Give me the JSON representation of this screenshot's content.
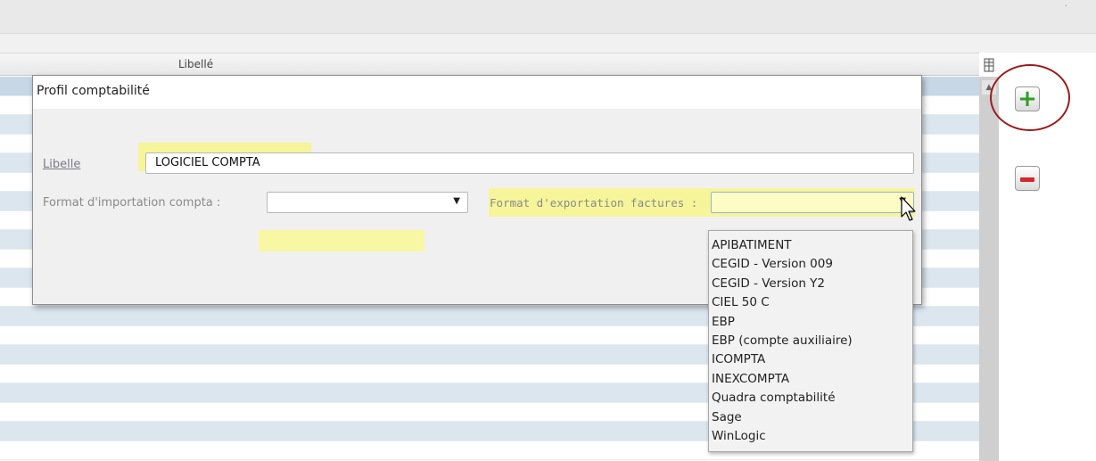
{
  "grid": {
    "column_header": "Libellé",
    "column_button_icon": "column-chooser-icon"
  },
  "dialog": {
    "title": "Profil comptabilité",
    "libelle_label": "Libelle",
    "libelle_value": "LOGICIEL COMPTA",
    "import_label": "Format d'importation compta :",
    "import_value": "",
    "export_label": "Format d'exportation factures :",
    "export_value": ""
  },
  "dropdown": {
    "options": [
      "APIBATIMENT",
      "CEGID - Version 009",
      "CEGID - Version Y2",
      "CIEL 50 C",
      "EBP",
      "EBP (compte auxiliaire)",
      "ICOMPTA",
      "INEXCOMPTA",
      "Quadra comptabilité",
      "Sage",
      "WinLogic"
    ]
  },
  "side_buttons": {
    "add_icon": "plus-icon",
    "remove_icon": "minus-icon",
    "add_color": "#2e9e26",
    "remove_color": "#d8262a"
  },
  "colors": {
    "highlight": "#f6f59a",
    "annotation_circle": "#9b1c1c",
    "row_alt": "#dbe6ef"
  }
}
